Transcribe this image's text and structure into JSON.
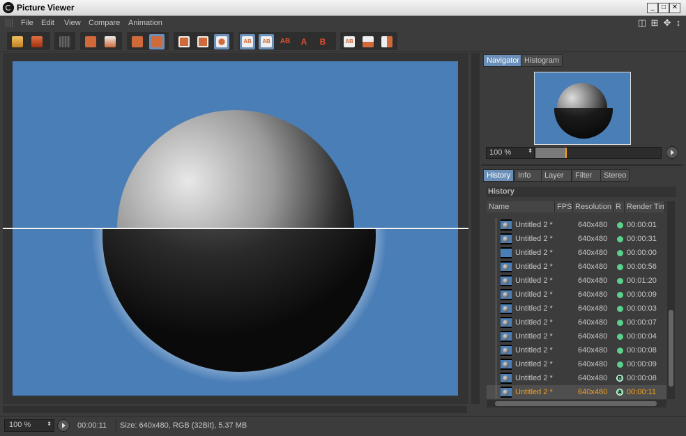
{
  "window": {
    "title": "Picture Viewer"
  },
  "menu": [
    "File",
    "Edit",
    "View",
    "Compare",
    "Animation"
  ],
  "navigator": {
    "tabs": [
      "Navigator",
      "Histogram"
    ],
    "zoom": "100 %"
  },
  "lower_tabs": [
    "History",
    "Info",
    "Layer",
    "Filter",
    "Stereo"
  ],
  "history": {
    "heading": "History",
    "columns": [
      "Name",
      "FPS",
      "Resolution",
      "R",
      "Render Tim"
    ],
    "rows": [
      {
        "name": "Untitled 2 *",
        "res": "640x480",
        "time": "00:00:01",
        "thumb": "sphere"
      },
      {
        "name": "Untitled 2 *",
        "res": "640x480",
        "time": "00:00:31",
        "thumb": "sphere"
      },
      {
        "name": "Untitled 2 *",
        "res": "640x480",
        "time": "00:00:00",
        "thumb": "blank"
      },
      {
        "name": "Untitled 2 *",
        "res": "640x480",
        "time": "00:00:56",
        "thumb": "sphere"
      },
      {
        "name": "Untitled 2 *",
        "res": "640x480",
        "time": "00:01:20",
        "thumb": "sphere"
      },
      {
        "name": "Untitled 2 *",
        "res": "640x480",
        "time": "00:00:09",
        "thumb": "sphere"
      },
      {
        "name": "Untitled 2 *",
        "res": "640x480",
        "time": "00:00:03",
        "thumb": "sphere"
      },
      {
        "name": "Untitled 2 *",
        "res": "640x480",
        "time": "00:00:07",
        "thumb": "sphere"
      },
      {
        "name": "Untitled 2 *",
        "res": "640x480",
        "time": "00:00:04",
        "thumb": "sphere"
      },
      {
        "name": "Untitled 2 *",
        "res": "640x480",
        "time": "00:00:08",
        "thumb": "sphere"
      },
      {
        "name": "Untitled 2 *",
        "res": "640x480",
        "time": "00:00:09",
        "thumb": "sphere"
      },
      {
        "name": "Untitled 2 *",
        "res": "640x480",
        "time": "00:00:08",
        "thumb": "sphere",
        "marker": "B"
      },
      {
        "name": "Untitled 2 *",
        "res": "640x480",
        "time": "00:00:11",
        "thumb": "sphere",
        "marker": "A",
        "selected": true
      }
    ]
  },
  "status": {
    "zoom": "100 %",
    "time": "00:00:11",
    "info": "Size: 640x480, RGB (32Bit), 5.37 MB"
  },
  "toolbar_labels": {
    "ab": "AB",
    "a": "A",
    "b": "B"
  },
  "colors": {
    "accent": "#6a8fb8",
    "canvas_bg": "#4a7eb7",
    "selected_text": "#f0a020",
    "status_dot": "#5bd08a"
  }
}
